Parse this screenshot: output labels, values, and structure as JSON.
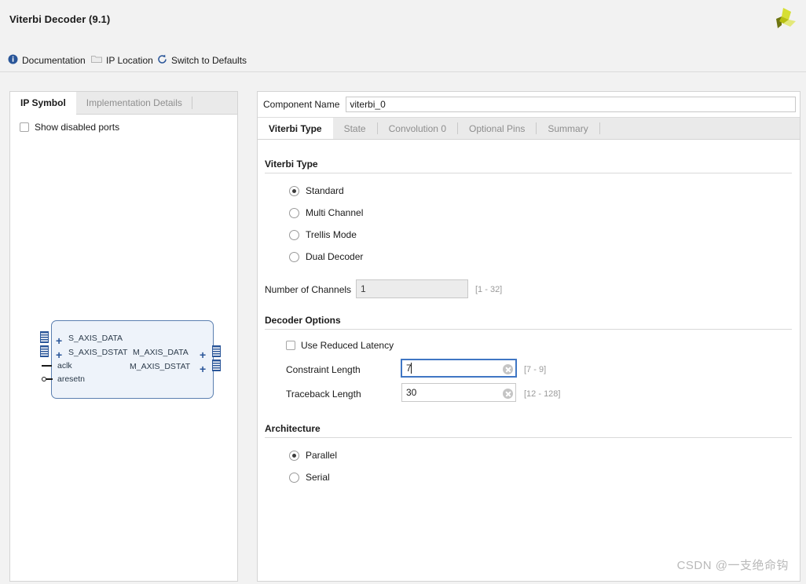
{
  "window": {
    "title": "Viterbi Decoder (9.1)",
    "logo_icon": "xilinx-pinwheel-logo",
    "logo_colors": [
      "#d6df33",
      "#b7bf10",
      "#6e7511",
      "#e3e87a"
    ]
  },
  "toolbar": {
    "items": [
      {
        "label": "Documentation",
        "icon": "info-icon",
        "enabled": true
      },
      {
        "label": "IP Location",
        "icon": "folder-icon",
        "enabled": false
      },
      {
        "label": "Switch to Defaults",
        "icon": "refresh-icon",
        "enabled": true
      }
    ]
  },
  "left_panel": {
    "tabs": [
      {
        "label": "IP Symbol",
        "active": true
      },
      {
        "label": "Implementation Details",
        "active": false
      }
    ],
    "show_disabled_ports": {
      "label": "Show disabled ports",
      "checked": false
    },
    "symbol": {
      "left_ports": [
        {
          "label": "S_AXIS_DATA",
          "type": "bus"
        },
        {
          "label": "S_AXIS_DSTAT",
          "type": "bus"
        },
        {
          "label": "aclk",
          "type": "clock"
        },
        {
          "label": "aresetn",
          "type": "reset_active_low"
        }
      ],
      "right_ports": [
        {
          "label": "M_AXIS_DATA",
          "type": "bus"
        },
        {
          "label": "M_AXIS_DSTAT",
          "type": "bus"
        }
      ]
    }
  },
  "right_panel": {
    "component_name": {
      "label": "Component Name",
      "value": "viterbi_0",
      "placeholder": ""
    },
    "tabs": [
      {
        "label": "Viterbi Type",
        "active": true
      },
      {
        "label": "State",
        "active": false
      },
      {
        "label": "Convolution 0",
        "active": false
      },
      {
        "label": "Optional Pins",
        "active": false
      },
      {
        "label": "Summary",
        "active": false
      }
    ],
    "sections": {
      "viterbi_type": {
        "title": "Viterbi Type",
        "options": [
          {
            "label": "Standard",
            "selected": true
          },
          {
            "label": "Multi Channel",
            "selected": false
          },
          {
            "label": "Trellis Mode",
            "selected": false
          },
          {
            "label": "Dual Decoder",
            "selected": false
          }
        ],
        "number_of_channels": {
          "label": "Number of Channels",
          "value": "1",
          "range": "[1 - 32]",
          "enabled": false
        }
      },
      "decoder_options": {
        "title": "Decoder Options",
        "use_reduced_latency": {
          "label": "Use Reduced Latency",
          "checked": false
        },
        "constraint_length": {
          "label": "Constraint Length",
          "value": "7",
          "range": "[7 - 9]",
          "focused": true,
          "clear_icon": "clear-circle-icon"
        },
        "traceback_length": {
          "label": "Traceback Length",
          "value": "30",
          "range": "[12 - 128]",
          "focused": false,
          "clear_icon": "clear-circle-icon"
        }
      },
      "architecture": {
        "title": "Architecture",
        "options": [
          {
            "label": "Parallel",
            "selected": true
          },
          {
            "label": "Serial",
            "selected": false
          }
        ]
      }
    }
  },
  "watermark": {
    "text": "CSDN @一支绝命钩"
  }
}
